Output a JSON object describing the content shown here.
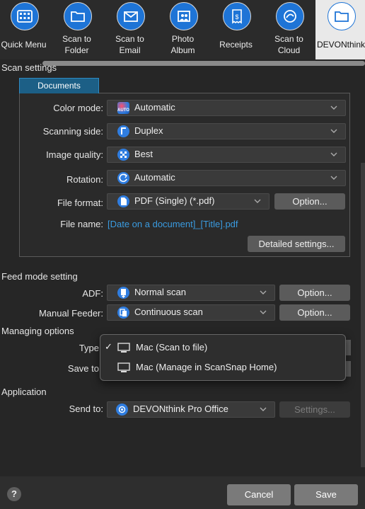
{
  "toolbar": {
    "items": [
      {
        "label": "Quick Menu",
        "icon": "grid-icon"
      },
      {
        "label": "Scan to\nFolder",
        "icon": "folder-icon"
      },
      {
        "label": "Scan to\nEmail",
        "icon": "envelope-icon"
      },
      {
        "label": "Photo\nAlbum",
        "icon": "photo-album-icon"
      },
      {
        "label": "Receipts",
        "icon": "receipt-icon"
      },
      {
        "label": "Scan to\nCloud",
        "icon": "cloud-icon"
      },
      {
        "label": "DEVONthink",
        "icon": "folder-icon",
        "selected": true
      }
    ]
  },
  "scan_settings": {
    "title": "Scan settings",
    "tab": "Documents",
    "color_mode": {
      "label": "Color mode:",
      "value": "Automatic",
      "icon": "auto-color-icon"
    },
    "scanning_side": {
      "label": "Scanning side:",
      "value": "Duplex",
      "icon": "duplex-icon"
    },
    "image_quality": {
      "label": "Image quality:",
      "value": "Best",
      "icon": "quality-icon"
    },
    "rotation": {
      "label": "Rotation:",
      "value": "Automatic",
      "icon": "rotation-icon"
    },
    "file_format": {
      "label": "File format:",
      "value": "PDF (Single) (*.pdf)",
      "icon": "pdf-file-icon",
      "option_button": "Option..."
    },
    "file_name": {
      "label": "File name:",
      "value": "[Date on a document]_[Title].pdf"
    },
    "detailed_button": "Detailed settings..."
  },
  "feed_mode": {
    "title": "Feed mode setting",
    "adf": {
      "label": "ADF:",
      "value": "Normal scan",
      "icon": "adf-icon",
      "option_button": "Option..."
    },
    "manual": {
      "label": "Manual Feeder:",
      "value": "Continuous scan",
      "icon": "continuous-icon",
      "option_button": "Option..."
    }
  },
  "managing": {
    "title": "Managing options",
    "type_label": "Type",
    "save_label": "Save to",
    "menu": [
      {
        "label": "Mac (Scan to file)",
        "checked": true
      },
      {
        "label": "Mac (Manage in ScanSnap Home)",
        "checked": false
      }
    ]
  },
  "application": {
    "title": "Application",
    "send_to_label": "Send to:",
    "send_to_value": "DEVONthink Pro Office",
    "settings_button": "Settings..."
  },
  "footer": {
    "help": "?",
    "cancel": "Cancel",
    "save": "Save"
  },
  "colors": {
    "accent": "#1e74d6",
    "tab": "#1c5f86",
    "link": "#3a9be0"
  }
}
